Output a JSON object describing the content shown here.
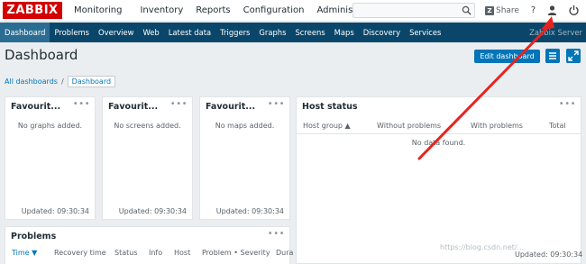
{
  "topbar": {
    "logo": "ZABBIX",
    "menu": [
      "Monitoring",
      "Inventory",
      "Reports",
      "Configuration",
      "Administration"
    ],
    "search_placeholder": "",
    "share_icon_letter": "Z",
    "share_label": "Share",
    "help_label": "?"
  },
  "subnav": {
    "items": [
      "Dashboard",
      "Problems",
      "Overview",
      "Web",
      "Latest data",
      "Triggers",
      "Graphs",
      "Screens",
      "Maps",
      "Discovery",
      "Services"
    ],
    "server": "Zabbix Server"
  },
  "header": {
    "title": "Dashboard",
    "edit_label": "Edit dashboard"
  },
  "breadcrumb": {
    "all": "All dashboards",
    "separator": "/",
    "current": "Dashboard"
  },
  "widgets": {
    "fav_graphs": {
      "title": "Favourit...",
      "empty": "No graphs added.",
      "updated": "Updated: 09:30:34"
    },
    "fav_screens": {
      "title": "Favourit...",
      "empty": "No screens added.",
      "updated": "Updated: 09:30:34"
    },
    "fav_maps": {
      "title": "Favourit...",
      "empty": "No maps added.",
      "updated": "Updated: 09:30:34"
    },
    "host_status": {
      "title": "Host status",
      "columns": [
        "Host group ▲",
        "Without problems",
        "With problems",
        "Total"
      ],
      "empty": "No data found.",
      "updated": "Updated: 09:30:34"
    },
    "problems": {
      "title": "Problems",
      "columns": [
        "Time ▼",
        "Recovery time",
        "Status",
        "Info",
        "Host",
        "Problem • Severity",
        "Dura"
      ]
    },
    "dots": "•••"
  },
  "watermark": "https://blog.csdn.net/..."
}
